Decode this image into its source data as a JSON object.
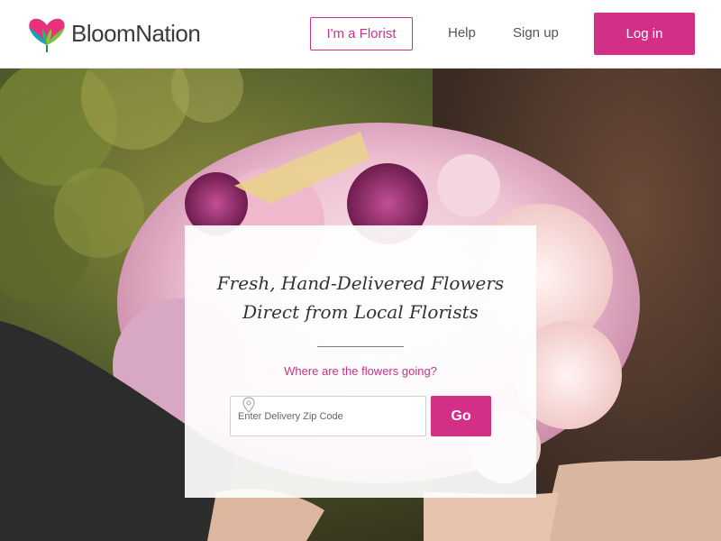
{
  "brand": {
    "name": "BloomNation",
    "logo_icon": "heart-leaf-logo-icon",
    "accent": "#d32f86"
  },
  "header": {
    "florist_button": "I'm a Florist",
    "help_link": "Help",
    "signup_link": "Sign up",
    "login_button": "Log in"
  },
  "hero": {
    "headline_line1": "Fresh, Hand-Delivered Flowers",
    "headline_line2": "Direct from Local Florists",
    "question": "Where are the flowers going?",
    "zip_placeholder": "Enter Delivery Zip Code",
    "zip_icon": "map-pin-icon",
    "go_button": "Go"
  }
}
